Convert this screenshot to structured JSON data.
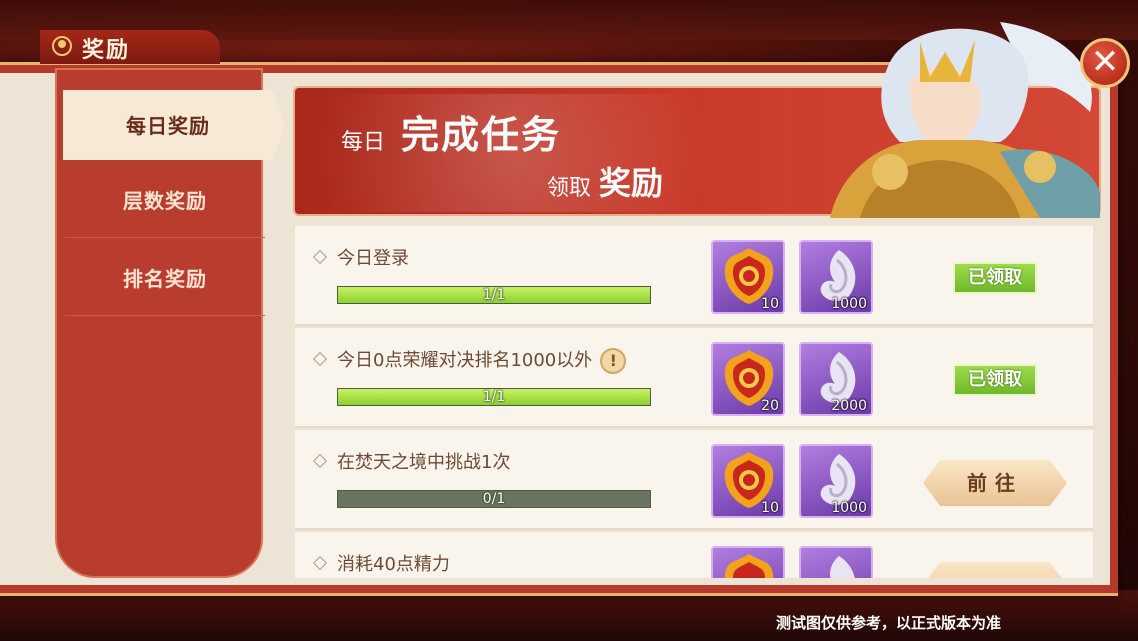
{
  "window": {
    "title": "奖励"
  },
  "sidebar": {
    "items": [
      {
        "label": "每日奖励",
        "active": true
      },
      {
        "label": "层数奖励",
        "active": false
      },
      {
        "label": "排名奖励",
        "active": false
      }
    ]
  },
  "banner": {
    "line1_small": "每日",
    "line1_big": "完成任务",
    "line2_small": "领取",
    "line2_big": "奖励"
  },
  "tasks": [
    {
      "title": "今日登录",
      "progress_text": "1/1",
      "progress": 1.0,
      "rewards": [
        {
          "icon": "honor-badge-icon",
          "count": "10"
        },
        {
          "icon": "spirit-feather-icon",
          "count": "1000"
        }
      ],
      "button": "已领取",
      "state": "claimed"
    },
    {
      "title": "今日0点荣耀对决排名1000以外",
      "progress_text": "1/1",
      "progress": 1.0,
      "info": "!",
      "rewards": [
        {
          "icon": "honor-badge-icon",
          "count": "20"
        },
        {
          "icon": "spirit-feather-icon",
          "count": "2000"
        }
      ],
      "button": "已领取",
      "state": "claimed"
    },
    {
      "title": "在焚天之境中挑战1次",
      "progress_text": "0/1",
      "progress": 0.0,
      "rewards": [
        {
          "icon": "honor-badge-icon",
          "count": "10"
        },
        {
          "icon": "spirit-feather-icon",
          "count": "1000"
        }
      ],
      "button": "前往",
      "state": "go"
    },
    {
      "title": "消耗40点精力",
      "progress_text": "",
      "progress": 0.0,
      "rewards": [
        {
          "icon": "honor-badge-icon",
          "count": ""
        },
        {
          "icon": "spirit-feather-icon",
          "count": ""
        }
      ],
      "button": "",
      "state": "go"
    }
  ],
  "footer": {
    "note": "测试图仅供参考，以正式版本为准"
  },
  "icons": {
    "close": "close-icon",
    "title": "reward-emblem-icon"
  },
  "colors": {
    "accent_red": "#b53a2c",
    "claimed_green": "#8bd12c",
    "gold": "#f0c577"
  }
}
